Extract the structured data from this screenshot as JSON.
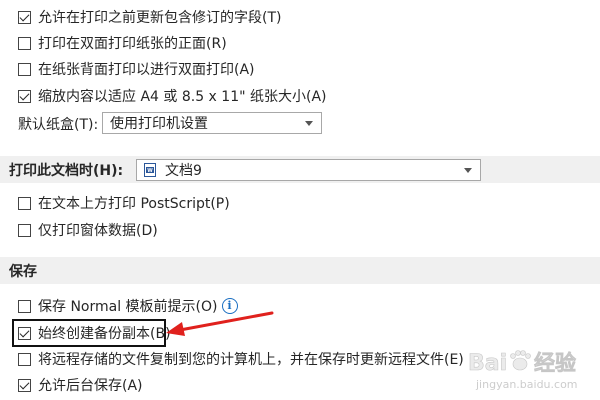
{
  "print_options": {
    "items": [
      {
        "label": "允许在打印之前更新包含修订的字段(T)",
        "checked": true
      },
      {
        "label": "打印在双面打印纸张的正面(R)",
        "checked": false
      },
      {
        "label": "在纸张背面打印以进行双面打印(A)",
        "checked": false
      },
      {
        "label": "缩放内容以适应 A4 或 8.5 x 11\" 纸张大小(A)",
        "checked": true
      }
    ],
    "tray_label": "默认纸盒(T):",
    "tray_value": "使用打印机设置"
  },
  "print_doc_section": {
    "title": "打印此文档时(H):",
    "doc_value": "文档9",
    "items": [
      {
        "label": "在文本上方打印 PostScript(P)",
        "checked": false
      },
      {
        "label": "仅打印窗体数据(D)",
        "checked": false
      }
    ]
  },
  "save_section": {
    "title": "保存",
    "items": [
      {
        "label": "保存 Normal 模板前提示(O)",
        "checked": false
      },
      {
        "label": "始终创建备份副本(B)",
        "checked": true
      },
      {
        "label": "将远程存储的文件复制到您的计算机上，并在保存时更新远程文件(E)",
        "checked": false
      },
      {
        "label": "允许后台保存(A)",
        "checked": true
      }
    ]
  },
  "icons": {
    "info": "info-icon",
    "document": "word-document-icon",
    "dropdown": "chevron-down-icon",
    "annotation": "red-arrow"
  },
  "colors": {
    "section_bg": "#f0f0f0",
    "info_blue": "#1b6fc2",
    "arrow_red": "#e0211d",
    "highlight_border": "#111111"
  },
  "watermark": {
    "brand_left": "Bai",
    "brand_right": "经验",
    "url": "jingyan.baidu.com"
  }
}
